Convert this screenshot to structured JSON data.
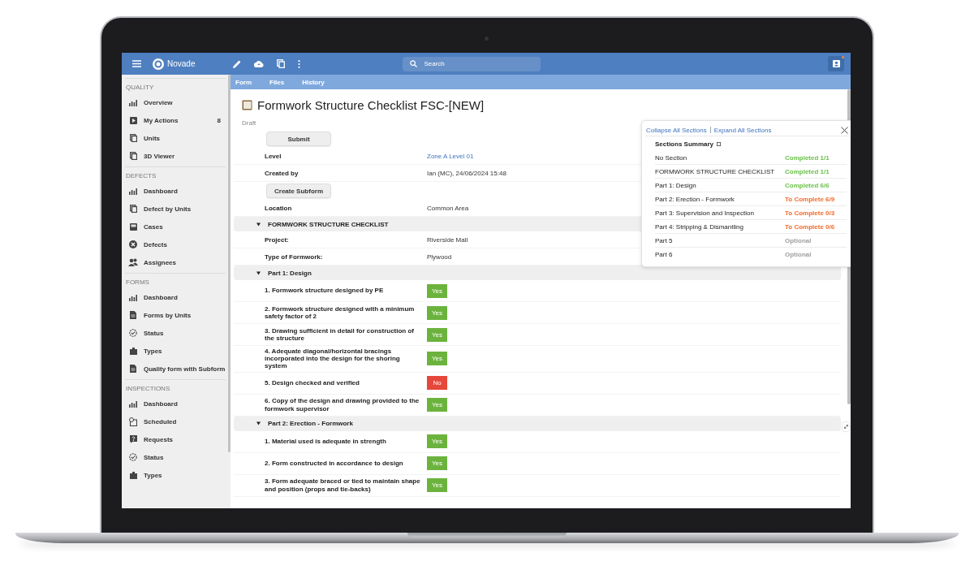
{
  "app": {
    "logo": "Novade",
    "search": {
      "placeholder": "Search"
    }
  },
  "sidebar": {
    "sections": [
      {
        "title": "QUALITY",
        "items": [
          {
            "label": "Overview",
            "kind": "chart"
          },
          {
            "label": "My Actions",
            "kind": "play",
            "count": "8"
          },
          {
            "label": "Units",
            "kind": "pages"
          },
          {
            "label": "3D Viewer",
            "kind": "pages"
          }
        ]
      },
      {
        "title": "DEFECTS",
        "items": [
          {
            "label": "Dashboard",
            "kind": "chart"
          },
          {
            "label": "Defect by Units",
            "kind": "pages"
          },
          {
            "label": "Cases",
            "kind": "tray"
          },
          {
            "label": "Defects",
            "kind": "cancel"
          },
          {
            "label": "Assignees",
            "kind": "people"
          }
        ]
      },
      {
        "title": "FORMS",
        "items": [
          {
            "label": "Dashboard",
            "kind": "chart"
          },
          {
            "label": "Forms by Units",
            "kind": "document"
          },
          {
            "label": "Status",
            "kind": "status"
          },
          {
            "label": "Types",
            "kind": "folder"
          },
          {
            "label": "Quality form with Subform",
            "kind": "document"
          }
        ]
      },
      {
        "title": "INSPECTIONS",
        "items": [
          {
            "label": "Dashboard",
            "kind": "chart"
          },
          {
            "label": "Scheduled",
            "kind": "schedule"
          },
          {
            "label": "Requests",
            "kind": "question"
          },
          {
            "label": "Status",
            "kind": "status"
          },
          {
            "label": "Types",
            "kind": "folder"
          }
        ]
      }
    ]
  },
  "tabs": [
    {
      "label": "Form"
    },
    {
      "label": "Files"
    },
    {
      "label": "History"
    }
  ],
  "form": {
    "title": "Formwork Structure Checklist FSC-[NEW]",
    "status": "Draft",
    "rows": [
      {
        "kind": "button",
        "label": "Submit"
      },
      {
        "kind": "field",
        "label": "Level",
        "value": "Zone A Level 01",
        "link": true
      },
      {
        "kind": "field",
        "label": "Created by",
        "value": "Ian (MC), 24/06/2024 15:48",
        "link": false
      },
      {
        "kind": "button",
        "label": "Create Subform"
      },
      {
        "kind": "field",
        "label": "Location",
        "value": "Common Area",
        "link": false
      }
    ],
    "sections": [
      {
        "title": "FORMWORK STRUCTURE CHECKLIST",
        "expanded": true,
        "rows": [
          {
            "kind": "field",
            "label": "Project:",
            "value": "Riverside Mall",
            "link": false
          },
          {
            "kind": "field",
            "label": "Type of Formwork:",
            "value": "Plywood",
            "link": false
          }
        ]
      },
      {
        "title": "Part 1: Design",
        "expanded": true,
        "rows": [
          {
            "kind": "question",
            "label": "1. Formwork structure designed by PE",
            "answer": "Yes",
            "color": "#6cb33e"
          },
          {
            "kind": "question",
            "label": "2. Formwork structure designed with a minimum safety factor of 2",
            "answer": "Yes",
            "color": "#6cb33e"
          },
          {
            "kind": "question",
            "label": "3. Drawing sufficient in detail for construction of the structure",
            "answer": "Yes",
            "color": "#6cb33e"
          },
          {
            "kind": "question",
            "label": "4. Adequate diagonal/horizontal bracings incorporated into the design for the shoring system",
            "answer": "Yes",
            "color": "#6cb33e"
          },
          {
            "kind": "question",
            "label": "5. Design checked and verified",
            "answer": "No",
            "color": "#e5473a"
          },
          {
            "kind": "question",
            "label": "6. Copy of the design and drawing provided to the formwork supervisor",
            "answer": "Yes",
            "color": "#6cb33e"
          }
        ]
      },
      {
        "title": "Part 2: Erection - Formwork",
        "expanded": true,
        "rows": [
          {
            "kind": "question",
            "label": "1. Material used is adequate in strength",
            "answer": "Yes",
            "color": "#6cb33e"
          },
          {
            "kind": "question",
            "label": "2. Form constructed in accordance to design",
            "answer": "Yes",
            "color": "#6cb33e"
          },
          {
            "kind": "question",
            "label": "3. Form adequate braced or tied to maintain shape and position (props and tie-backs)",
            "answer": "Yes",
            "color": "#6cb33e"
          }
        ]
      }
    ]
  },
  "summary": {
    "links": [
      "Collapse All Sections",
      "Expand All Sections"
    ],
    "title": "Sections Summary",
    "rows": [
      {
        "name": "No Section",
        "status": "Completed 1/1",
        "color": "#6cc04a"
      },
      {
        "name": "FORMWORK STRUCTURE CHECKLIST",
        "status": "Completed 1/1",
        "color": "#6cc04a"
      },
      {
        "name": "Part 1: Design",
        "status": "Completed 6/6",
        "color": "#6cc04a"
      },
      {
        "name": "Part 2: Erection - Formwork",
        "status": "To Complete 6/9",
        "color": "#f26b2a"
      },
      {
        "name": "Part 3: Supervision and Inspection",
        "status": "To Complete 0/3",
        "color": "#f26b2a"
      },
      {
        "name": "Part 4: Stripping & Dismantling",
        "status": "To Complete 0/6",
        "color": "#f26b2a"
      },
      {
        "name": "Part 5",
        "status": "Optional",
        "color": "#a0a0a0"
      },
      {
        "name": "Part 6",
        "status": "Optional",
        "color": "#a0a0a0"
      }
    ]
  }
}
